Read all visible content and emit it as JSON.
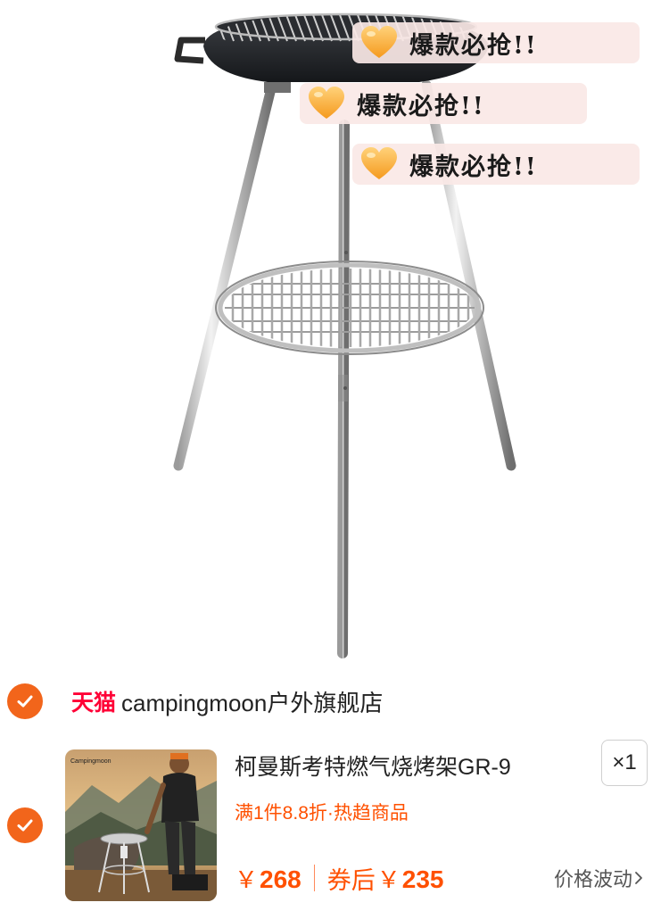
{
  "promo_bubbles": [
    {
      "text": "爆款必抢!!",
      "icon": "heart-icon"
    },
    {
      "text": "爆款必抢!!",
      "icon": "heart-icon"
    },
    {
      "text": "爆款必抢!!",
      "icon": "heart-icon"
    }
  ],
  "shop": {
    "platform": "天猫",
    "name": "campingmoon户外旗舰店",
    "selected": true
  },
  "item": {
    "selected": true,
    "title": "柯曼斯考特燃气烧烤架GR-9",
    "quantity": "×1",
    "promo": "满1件8.8折·热趋商品",
    "currency": "￥",
    "price": "268",
    "coupon_label": "券后",
    "coupon_price": "235",
    "fluctuation_label": "价格波动",
    "thumbnail_brand": "Campingmoon"
  },
  "colors": {
    "accent": "#ff5000",
    "check": "#f2651b",
    "tmall": "#ff0036"
  }
}
